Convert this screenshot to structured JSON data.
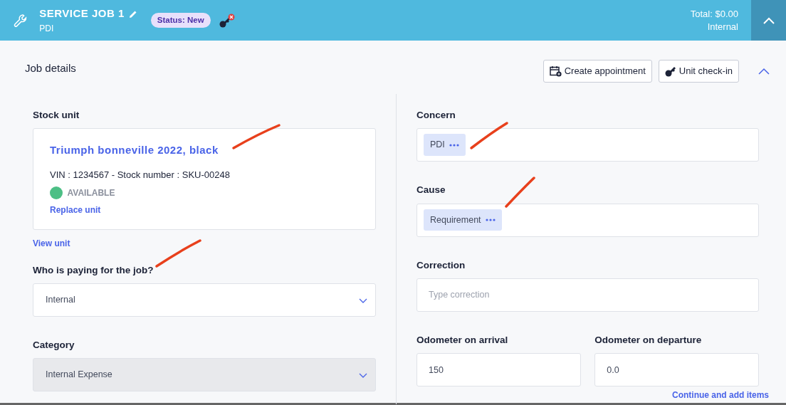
{
  "header": {
    "title": "SERVICE JOB 1",
    "subtitle": "PDI",
    "status_badge": "Status: New",
    "total": "Total: $0.00",
    "payer": "Internal",
    "expanded": true
  },
  "section": {
    "title": "Job details",
    "expanded": true,
    "buttons": [
      {
        "label": "Create appointment",
        "kind": "calendar"
      },
      {
        "label": "Unit check-in",
        "kind": "key"
      }
    ]
  },
  "stock_unit": {
    "label": "Stock unit",
    "name": "Triumph bonneville 2022, black",
    "details": "VIN : 1234567 - Stock number : SKU-00248",
    "status": {
      "label": "AVAILABLE",
      "color": "#4cbf85"
    },
    "replace_link": "Replace unit",
    "view_link": "View unit"
  },
  "left_fields": [
    {
      "label": "Who is paying for the job?",
      "value": "Internal",
      "disabled": false
    },
    {
      "label": "Category",
      "value": "Internal Expense",
      "disabled": true
    }
  ],
  "right_fields": [
    {
      "label": "Concern",
      "kind": "chips",
      "chips": [
        "PDI"
      ]
    },
    {
      "label": "Cause",
      "kind": "chips",
      "chips": [
        "Requirement"
      ]
    },
    {
      "label": "Correction",
      "kind": "text",
      "placeholder": "Type correction"
    }
  ],
  "odometer": [
    {
      "label": "Odometer on arrival",
      "value": "150"
    },
    {
      "label": "Odometer on departure",
      "value": "0.0"
    }
  ],
  "continue_link": "Continue and add items"
}
